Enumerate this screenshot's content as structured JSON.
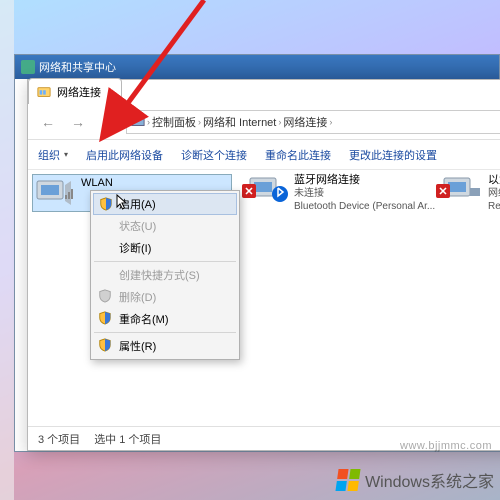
{
  "parent_window": {
    "title": "网络和共享中心"
  },
  "explorer": {
    "tab": "网络连接",
    "breadcrumb": [
      "控制面板",
      "网络和 Internet",
      "网络连接"
    ],
    "toolbar": {
      "organize": "组织",
      "enable": "启用此网络设备",
      "diagnose": "诊断这个连接",
      "rename": "重命名此连接",
      "change_settings": "更改此连接的设置"
    }
  },
  "connections": {
    "wlan": {
      "name": "WLAN",
      "status": "",
      "device": ""
    },
    "bluetooth": {
      "name": "蓝牙网络连接",
      "status": "未连接",
      "device": "Bluetooth Device (Personal Ar..."
    },
    "ethernet": {
      "name": "以太网",
      "status": "网络电缆被拔出",
      "device": "Realtek PCIe G"
    }
  },
  "context_menu": {
    "enable": "启用(A)",
    "status": "状态(U)",
    "diagnose": "诊断(I)",
    "shortcut": "创建快捷方式(S)",
    "delete": "删除(D)",
    "rename": "重命名(M)",
    "properties": "属性(R)"
  },
  "statusbar": {
    "count": "3 个项目",
    "selected": "选中 1 个项目"
  },
  "watermark": {
    "text": "Windows系统之家",
    "url": "www.bjjmmc.com"
  }
}
